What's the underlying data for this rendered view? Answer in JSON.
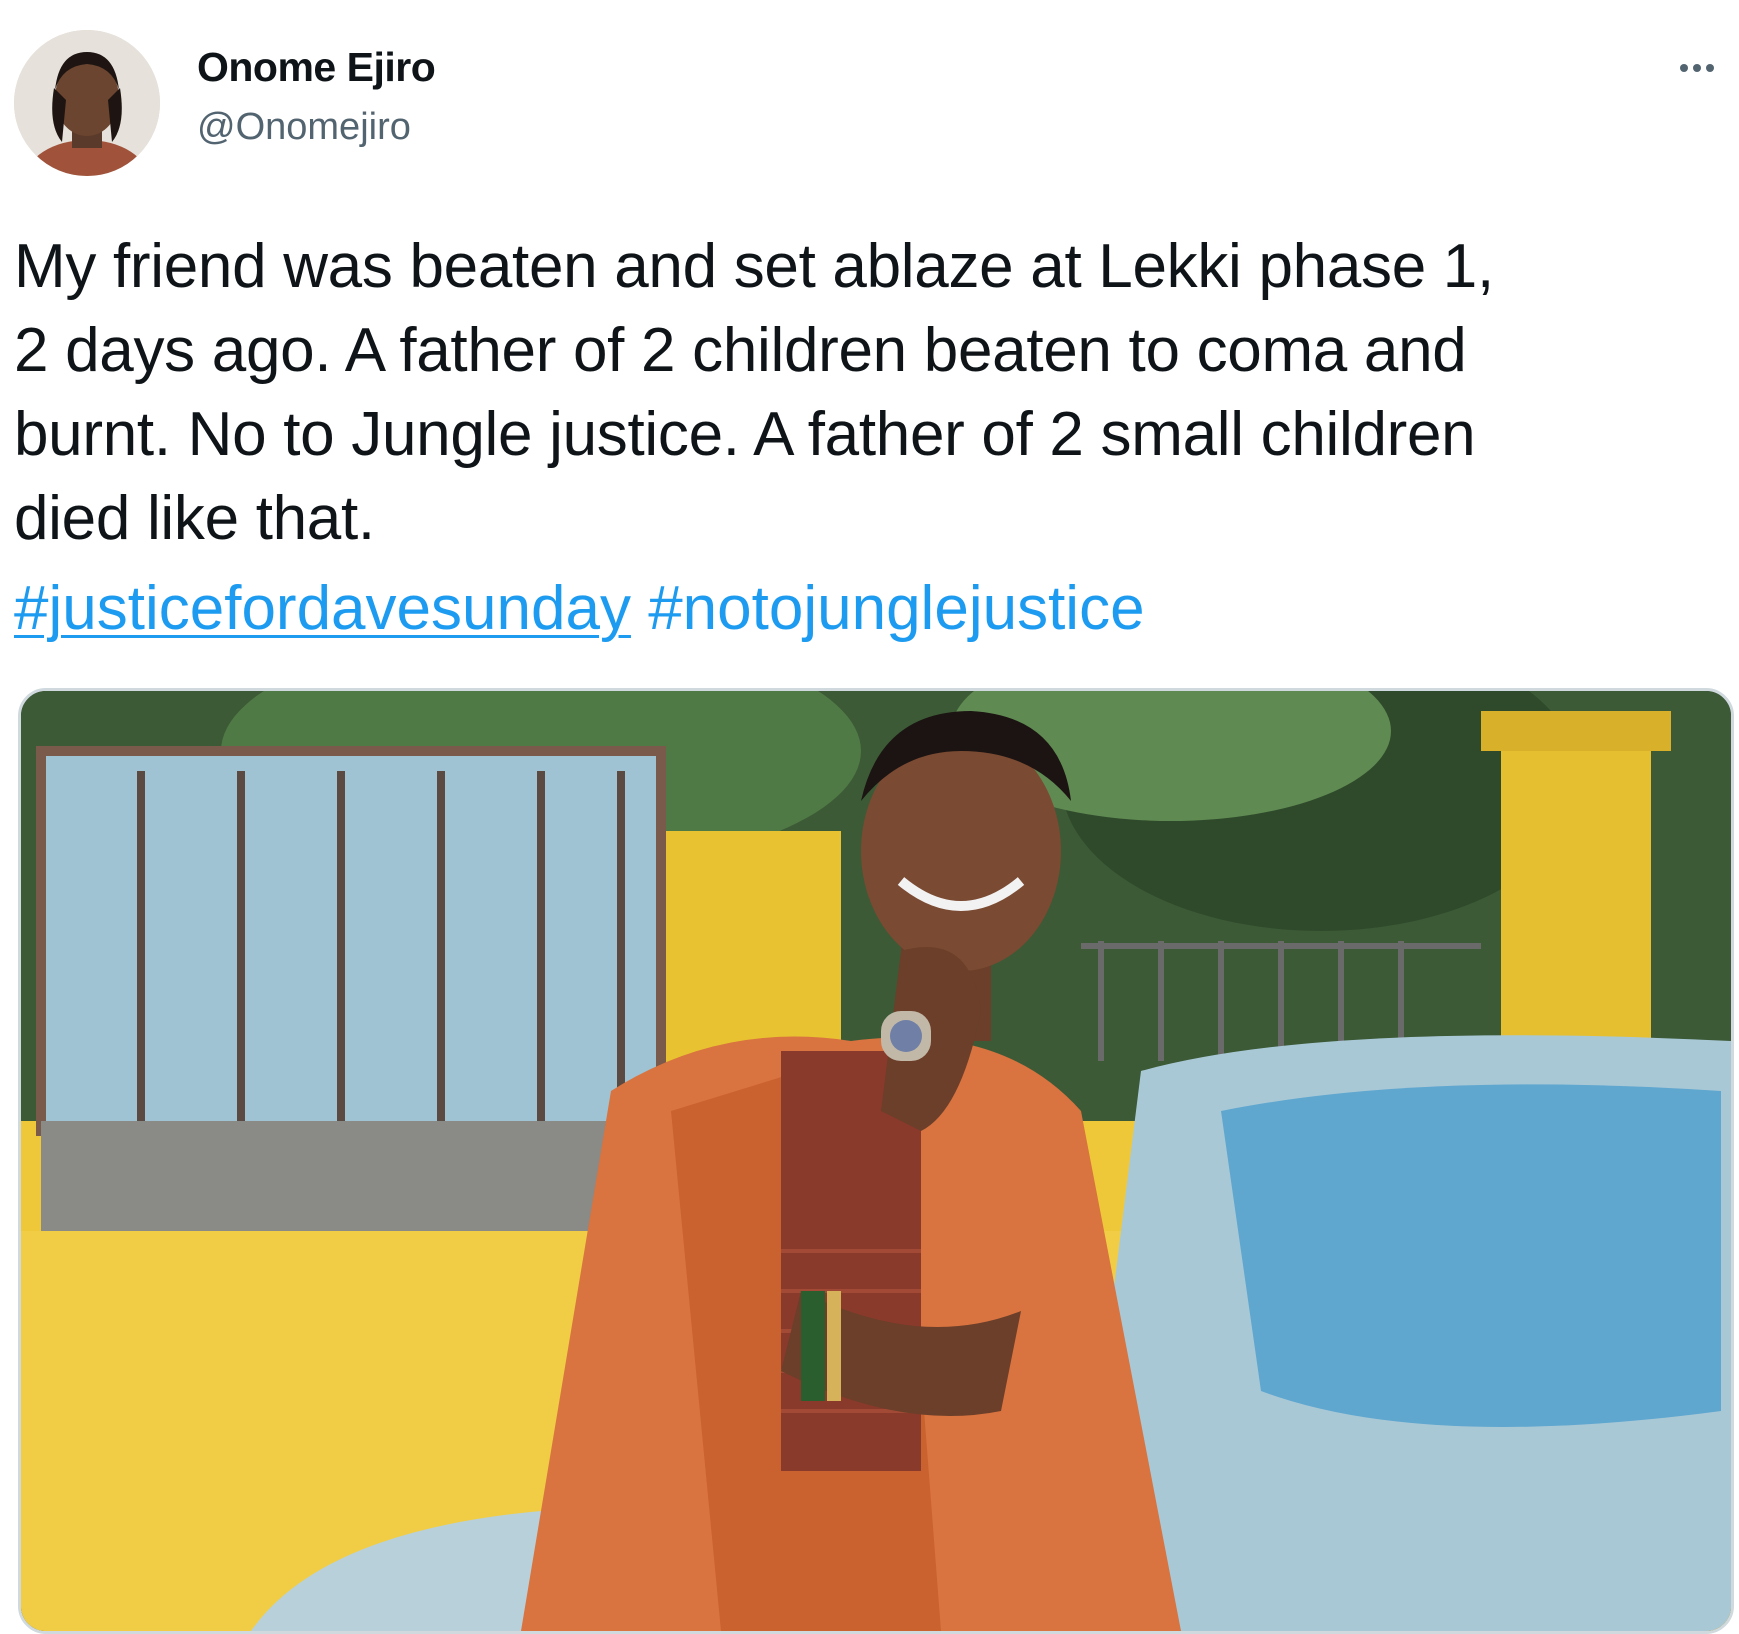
{
  "author": {
    "display_name": "Onome Ejiro",
    "handle": "@Onomejiro"
  },
  "tweet": {
    "text_lines": [
      "My friend was beaten and set ablaze at Lekki phase 1,",
      "2 days ago. A father of 2 children beaten to coma and",
      "burnt. No to Jungle justice. A father of 2 small children",
      "died like that."
    ],
    "hashtags": [
      "#justicefordavesunday",
      "#notojunglejustice"
    ]
  },
  "icons": {
    "more": "more-horizontal-icon"
  },
  "colors": {
    "link": "#1d9bf0",
    "text": "#0f1419",
    "secondary": "#536471"
  }
}
